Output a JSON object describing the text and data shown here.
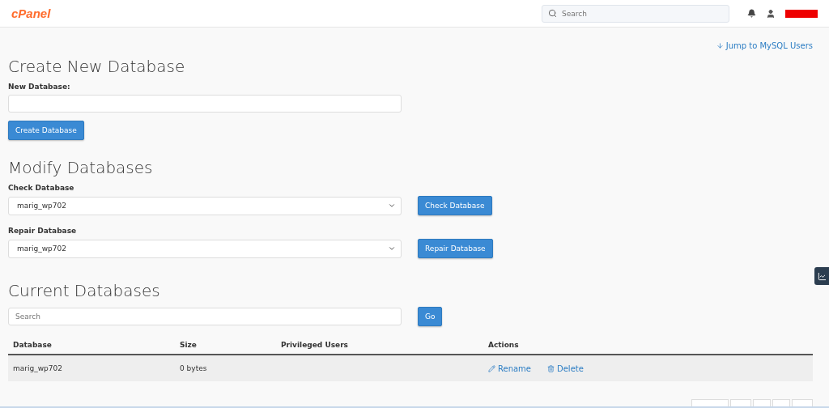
{
  "header": {
    "logo": "cPanel",
    "search": {
      "placeholder": "Search"
    }
  },
  "jump_link": "Jump to MySQL Users",
  "create": {
    "title": "Create New Database",
    "label": "New Database:",
    "button": "Create Database"
  },
  "modify": {
    "title": "Modify Databases",
    "rows": [
      {
        "label": "Check Database",
        "value": "marig_wp702",
        "button": "Check Database"
      },
      {
        "label": "Repair Database",
        "value": "marig_wp702",
        "button": "Repair Database"
      }
    ]
  },
  "current": {
    "title": "Current Databases",
    "search": {
      "placeholder": "Search"
    },
    "go": "Go",
    "table": {
      "columns": [
        "Database",
        "Size",
        "Privileged Users",
        "Actions"
      ],
      "rows": [
        {
          "database": "marig_wp702",
          "size": "0 bytes",
          "users": "",
          "actions": [
            {
              "kind": "rename",
              "label": "Rename"
            },
            {
              "kind": "delete",
              "label": "Delete"
            }
          ]
        }
      ]
    }
  }
}
